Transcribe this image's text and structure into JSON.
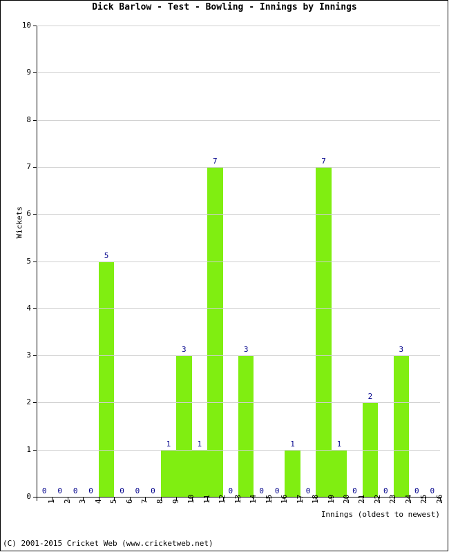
{
  "chart_data": {
    "type": "bar",
    "title": "Dick Barlow - Test - Bowling - Innings by Innings",
    "xlabel": "Innings (oldest to newest)",
    "ylabel": "Wickets",
    "categories": [
      "1",
      "2",
      "3",
      "4",
      "5",
      "6",
      "7",
      "8",
      "9",
      "10",
      "11",
      "12",
      "13",
      "14",
      "15",
      "16",
      "17",
      "18",
      "19",
      "20",
      "21",
      "22",
      "23",
      "24",
      "25",
      "26"
    ],
    "values": [
      0,
      0,
      0,
      0,
      5,
      0,
      0,
      0,
      1,
      3,
      1,
      7,
      0,
      3,
      0,
      0,
      1,
      0,
      7,
      1,
      0,
      2,
      0,
      3,
      0,
      0
    ],
    "ylim": [
      0,
      10
    ],
    "yticks": [
      "0",
      "1",
      "2",
      "3",
      "4",
      "5",
      "6",
      "7",
      "8",
      "9",
      "10"
    ],
    "grid": true,
    "legend": null,
    "bar_color": "#80ee11",
    "label_color": "#00008b",
    "gridline_color": "#d0d0d0",
    "axis_color": "#000000"
  },
  "footer": {
    "copyright": "(C) 2001-2015 Cricket Web (www.cricketweb.net)"
  }
}
